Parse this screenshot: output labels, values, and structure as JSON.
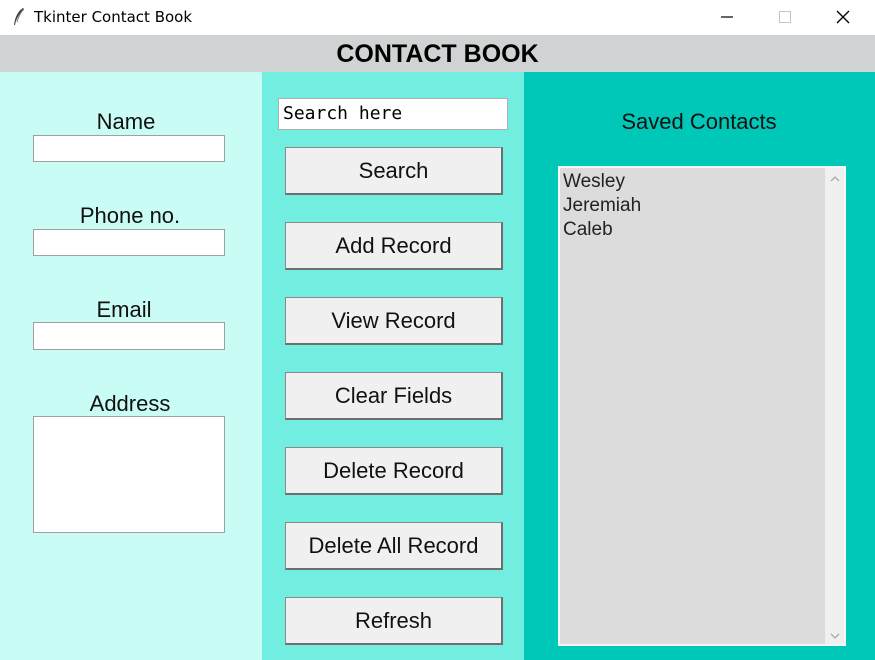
{
  "window": {
    "title": "Tkinter Contact Book",
    "minimize_icon": "minimize-icon",
    "maximize_icon": "maximize-icon",
    "close_icon": "close-icon"
  },
  "header": {
    "title": "CONTACT BOOK"
  },
  "form": {
    "name_label": "Name",
    "phone_label": "Phone no.",
    "email_label": "Email",
    "address_label": "Address",
    "name_value": "",
    "phone_value": "",
    "email_value": "",
    "address_value": ""
  },
  "search": {
    "value": "Search here"
  },
  "buttons": {
    "search": "Search",
    "add": "Add Record",
    "view": "View Record",
    "clear": "Clear Fields",
    "delete": "Delete Record",
    "delete_all": "Delete All Record",
    "refresh": "Refresh"
  },
  "contacts": {
    "title": "Saved Contacts",
    "items": [
      "Wesley",
      "Jeremiah",
      "Caleb"
    ]
  },
  "colors": {
    "left_panel": "#c9fcf4",
    "middle_panel": "#72eee0",
    "right_panel": "#00c8b8",
    "header_band": "#d0d3d4"
  }
}
